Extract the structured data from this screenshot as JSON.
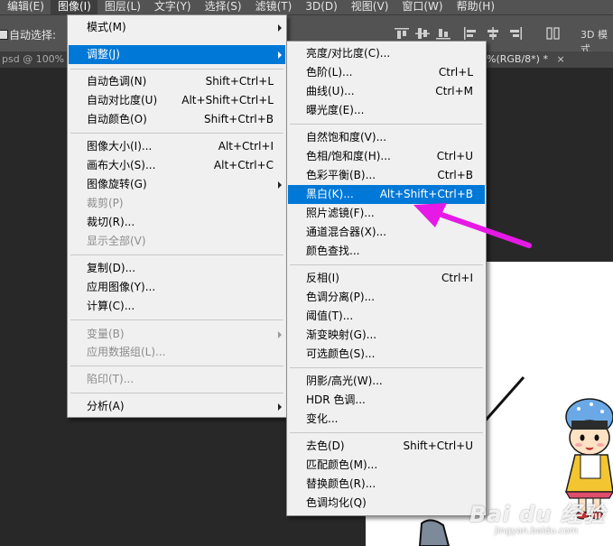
{
  "menubar": {
    "items": [
      {
        "label": "编辑(E)"
      },
      {
        "label": "图像(I)",
        "active": true
      },
      {
        "label": "图层(L)"
      },
      {
        "label": "文字(Y)"
      },
      {
        "label": "选择(S)"
      },
      {
        "label": "滤镜(T)"
      },
      {
        "label": "3D(D)"
      },
      {
        "label": "视图(V)"
      },
      {
        "label": "窗口(W)"
      },
      {
        "label": "帮助(H)"
      }
    ]
  },
  "options_bar": {
    "auto_select_label": "自动选择:",
    "mode_3d_label": "3D 模式"
  },
  "tabs": {
    "left": "psd @ 100%",
    "right": "%(RGB/8*) *",
    "close": "×"
  },
  "image_menu": {
    "items": [
      {
        "label": "模式(M)",
        "shortcut": "",
        "submenu": true,
        "disabled": false
      },
      {
        "label": "调整(J)",
        "shortcut": "",
        "submenu": true,
        "disabled": false,
        "highlighted": true
      },
      {
        "sep": true
      },
      {
        "label": "自动色调(N)",
        "shortcut": "Shift+Ctrl+L"
      },
      {
        "label": "自动对比度(U)",
        "shortcut": "Alt+Shift+Ctrl+L"
      },
      {
        "label": "自动颜色(O)",
        "shortcut": "Shift+Ctrl+B"
      },
      {
        "sep": true
      },
      {
        "label": "图像大小(I)...",
        "shortcut": "Alt+Ctrl+I"
      },
      {
        "label": "画布大小(S)...",
        "shortcut": "Alt+Ctrl+C"
      },
      {
        "label": "图像旋转(G)",
        "shortcut": "",
        "submenu": true
      },
      {
        "label": "裁剪(P)",
        "shortcut": "",
        "disabled": true
      },
      {
        "label": "裁切(R)...",
        "shortcut": ""
      },
      {
        "label": "显示全部(V)",
        "shortcut": "",
        "disabled": true
      },
      {
        "sep": true
      },
      {
        "label": "复制(D)...",
        "shortcut": ""
      },
      {
        "label": "应用图像(Y)...",
        "shortcut": ""
      },
      {
        "label": "计算(C)...",
        "shortcut": ""
      },
      {
        "sep": true
      },
      {
        "label": "变量(B)",
        "shortcut": "",
        "submenu": true,
        "disabled": true
      },
      {
        "label": "应用数据组(L)...",
        "shortcut": "",
        "disabled": true
      },
      {
        "sep": true
      },
      {
        "label": "陷印(T)...",
        "shortcut": "",
        "disabled": true
      },
      {
        "sep": true
      },
      {
        "label": "分析(A)",
        "shortcut": "",
        "submenu": true
      }
    ]
  },
  "adjust_menu": {
    "items": [
      {
        "label": "亮度/对比度(C)...",
        "shortcut": ""
      },
      {
        "label": "色阶(L)...",
        "shortcut": "Ctrl+L"
      },
      {
        "label": "曲线(U)...",
        "shortcut": "Ctrl+M"
      },
      {
        "label": "曝光度(E)...",
        "shortcut": ""
      },
      {
        "sep": true
      },
      {
        "label": "自然饱和度(V)...",
        "shortcut": ""
      },
      {
        "label": "色相/饱和度(H)...",
        "shortcut": "Ctrl+U"
      },
      {
        "label": "色彩平衡(B)...",
        "shortcut": "Ctrl+B"
      },
      {
        "label": "黑白(K)...",
        "shortcut": "Alt+Shift+Ctrl+B",
        "highlighted": true
      },
      {
        "label": "照片滤镜(F)...",
        "shortcut": ""
      },
      {
        "label": "通道混合器(X)...",
        "shortcut": ""
      },
      {
        "label": "颜色查找...",
        "shortcut": ""
      },
      {
        "sep": true
      },
      {
        "label": "反相(I)",
        "shortcut": "Ctrl+I"
      },
      {
        "label": "色调分离(P)...",
        "shortcut": ""
      },
      {
        "label": "阈值(T)...",
        "shortcut": ""
      },
      {
        "label": "渐变映射(G)...",
        "shortcut": ""
      },
      {
        "label": "可选颜色(S)...",
        "shortcut": ""
      },
      {
        "sep": true
      },
      {
        "label": "阴影/高光(W)...",
        "shortcut": ""
      },
      {
        "label": "HDR 色调...",
        "shortcut": ""
      },
      {
        "label": "变化...",
        "shortcut": ""
      },
      {
        "sep": true
      },
      {
        "label": "去色(D)",
        "shortcut": "Shift+Ctrl+U"
      },
      {
        "label": "匹配颜色(M)...",
        "shortcut": ""
      },
      {
        "label": "替换颜色(R)...",
        "shortcut": ""
      },
      {
        "label": "色调均化(Q)",
        "shortcut": ""
      }
    ]
  },
  "watermark": {
    "brand": "Bai du 经验",
    "url": "jingyan.baidu.com"
  },
  "colors": {
    "highlight": "#0078d7",
    "annotation_arrow": "#e619e6",
    "menu_bg": "#f0f0f0"
  }
}
